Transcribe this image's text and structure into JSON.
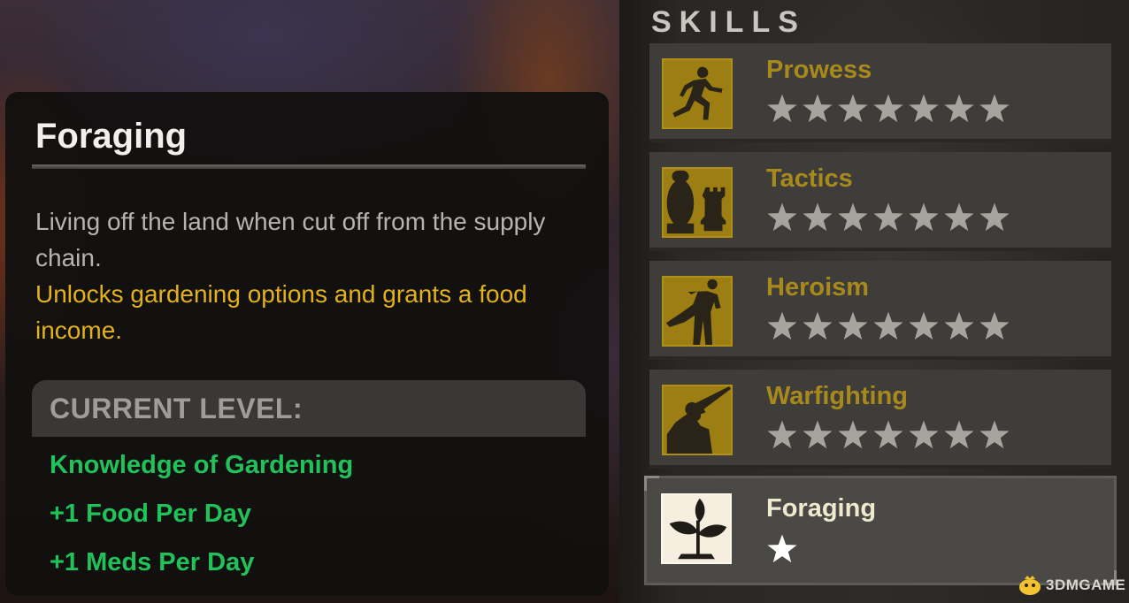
{
  "tooltip": {
    "title": "Foraging",
    "description": "Living off the land when cut off from the supply chain.",
    "unlock_text": "Unlocks gardening options and grants a food income.",
    "current_level_label": "CURRENT LEVEL:",
    "perks": [
      "Knowledge of Gardening",
      "+1 Food Per Day",
      "+1 Meds Per Day"
    ]
  },
  "skills_panel": {
    "title": "SKILLS",
    "skills": [
      {
        "name": "Prowess",
        "icon": "runner-icon",
        "stars_filled": 0,
        "stars_total": 7,
        "selected": false
      },
      {
        "name": "Tactics",
        "icon": "chess-pieces-icon",
        "stars_filled": 0,
        "stars_total": 7,
        "selected": false
      },
      {
        "name": "Heroism",
        "icon": "high-kick-icon",
        "stars_filled": 0,
        "stars_total": 7,
        "selected": false
      },
      {
        "name": "Warfighting",
        "icon": "rifleman-icon",
        "stars_filled": 0,
        "stars_total": 7,
        "selected": false
      },
      {
        "name": "Foraging",
        "icon": "sprout-icon",
        "stars_filled": 1,
        "stars_total": 1,
        "selected": true
      }
    ]
  },
  "watermark": {
    "text": "3DMGAME"
  },
  "colors": {
    "title_text": "#f2f0ec",
    "description_text": "#b7b4ae",
    "unlock_text": "#e2b11c",
    "perk_text": "#22c25a",
    "skill_name_unselected": "#a8891c",
    "skill_name_selected": "#efe9cf",
    "skill_icon_bg": "#9c7e12",
    "skill_icon_bg_selected": "#f6efe0",
    "star_empty": "#a6a49f",
    "star_filled": "#ffffff"
  }
}
